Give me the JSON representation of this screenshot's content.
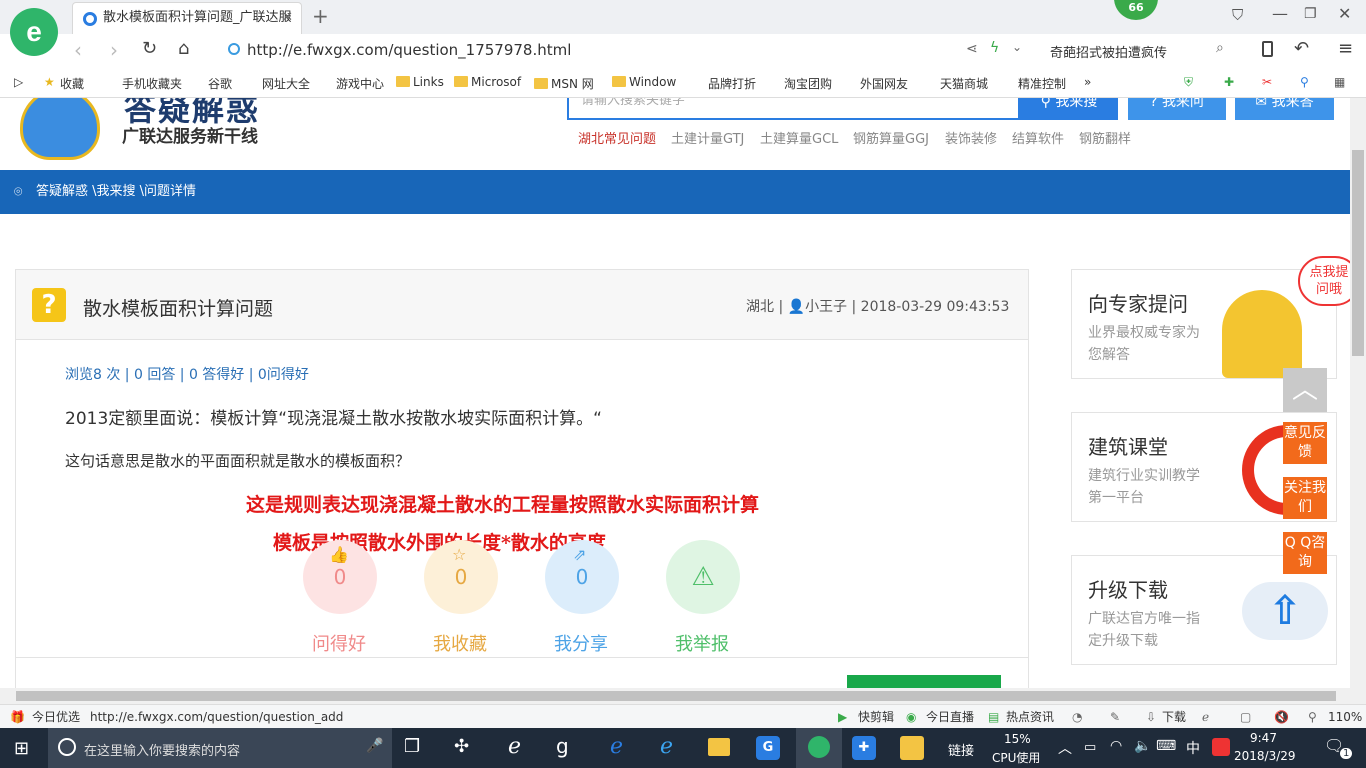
{
  "browser": {
    "tab_title": "散水模板面积计算问题_广联达服",
    "badge": "66",
    "url": "http://e.fwxgx.com/question_1757978.html",
    "search_text": "奇葩招式被拍遭疯传",
    "favorites": [
      "收藏",
      "手机收藏夹",
      "谷歌",
      "网址大全",
      "游戏中心",
      "Links",
      "Microsof",
      "MSN 网",
      "Window",
      "品牌打折",
      "淘宝团购",
      "外国网友",
      "天猫商城",
      "精准控制"
    ]
  },
  "site": {
    "logo_main": "答疑解惑",
    "logo_sub": "广联达服务新干线",
    "search_placeholder": "请输入搜索关键字",
    "search_buttons": [
      "我来搜",
      "我来问",
      "我来答"
    ],
    "quick_links": [
      "湖北常见问题",
      "土建计量GTJ",
      "土建算量GCL",
      "钢筋算量GGJ",
      "装饰装修",
      "结算软件",
      "钢筋翻样"
    ],
    "breadcrumb": "答疑解惑 \\我来搜 \\问题详情"
  },
  "question": {
    "title": "散水模板面积计算问题",
    "meta_region": "湖北 |",
    "meta_user": "小王子",
    "meta_time": "| 2018-03-29 09:43:53",
    "stats": "浏览8 次 | 0 回答 | 0 答得好 | 0问得好",
    "line1": "2013定额里面说：模板计算“现浇混凝土散水按散水坡实际面积计算。“",
    "line2": "这句话意思是散水的平面面积就是散水的模板面积？",
    "answer1": "这是规则表达现浇混凝土散水的工程量按照散水实际面积计算",
    "answer2": "模板是按照散水外围的长度*散水的高度",
    "actions": [
      {
        "count": "0",
        "label": "问得好",
        "color": "#f08a8a"
      },
      {
        "count": "0",
        "label": "我收藏",
        "color": "#e6a842"
      },
      {
        "count": "0",
        "label": "我分享",
        "color": "#4da3e6"
      },
      {
        "label": "我举报",
        "color": "#4fbf6a"
      }
    ]
  },
  "sidebar": [
    {
      "title": "向专家提问",
      "desc": "业界最权威专家为您解答",
      "bubble": "点我提问哦"
    },
    {
      "title": "建筑课堂",
      "desc": "建筑行业实训教学第一平台"
    },
    {
      "title": "升级下载",
      "desc": "广联达官方唯一指定升级下载"
    }
  ],
  "float_buttons": [
    "意见反馈",
    "关注我们",
    "Q Q咨询"
  ],
  "status_bar": {
    "left": "今日优选",
    "url": "http://e.fwxgx.com/question/question_add",
    "items": [
      "快剪辑",
      "今日直播",
      "热点资讯",
      "下载"
    ],
    "zoom": "110%"
  },
  "taskbar": {
    "search_placeholder": "在这里输入你要搜索的内容",
    "link_label": "链接",
    "cpu_percent": "15%",
    "cpu_label": "CPU使用",
    "ime": "中",
    "time": "9:47",
    "date": "2018/3/29",
    "notif_count": "1"
  }
}
